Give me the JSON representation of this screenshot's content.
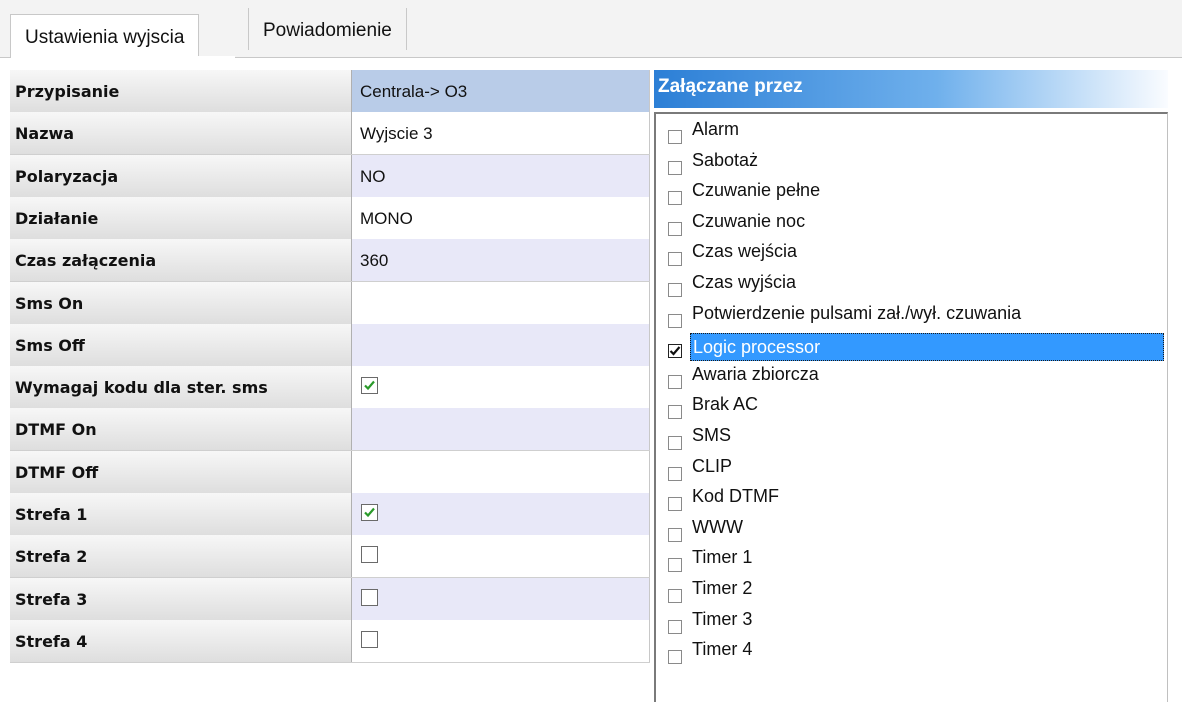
{
  "tabs": [
    {
      "label": "Ustawienia wyjscia",
      "active": true
    },
    {
      "label": "Powiadomienie",
      "active": false
    }
  ],
  "properties": [
    {
      "label": "Przypisanie",
      "value": "Centrala-> O3",
      "kind": "text"
    },
    {
      "label": "Nazwa",
      "value": "Wyjscie 3",
      "kind": "text"
    },
    {
      "label": "Polaryzacja",
      "value": "NO",
      "kind": "text"
    },
    {
      "label": "Działanie",
      "value": "MONO",
      "kind": "text"
    },
    {
      "label": "Czas załączenia",
      "value": "360",
      "kind": "text"
    },
    {
      "label": "Sms On",
      "value": "",
      "kind": "text"
    },
    {
      "label": "Sms Off",
      "value": "",
      "kind": "text"
    },
    {
      "label": "Wymagaj kodu dla ster. sms",
      "checked": true,
      "kind": "checkbox"
    },
    {
      "label": "DTMF On",
      "value": "",
      "kind": "text"
    },
    {
      "label": "DTMF Off",
      "value": "",
      "kind": "text"
    },
    {
      "label": "Strefa 1",
      "checked": true,
      "kind": "checkbox"
    },
    {
      "label": "Strefa 2",
      "checked": false,
      "kind": "checkbox"
    },
    {
      "label": "Strefa 3",
      "checked": false,
      "kind": "checkbox"
    },
    {
      "label": "Strefa 4",
      "checked": false,
      "kind": "checkbox"
    }
  ],
  "triggered_by": {
    "title": "Załączane przez",
    "items": [
      {
        "label": "Alarm",
        "checked": false
      },
      {
        "label": "Sabotaż",
        "checked": false
      },
      {
        "label": "Czuwanie pełne",
        "checked": false
      },
      {
        "label": "Czuwanie noc",
        "checked": false
      },
      {
        "label": "Czas wejścia",
        "checked": false
      },
      {
        "label": "Czas wyjścia",
        "checked": false
      },
      {
        "label": "Potwierdzenie pulsami zał./wył. czuwania",
        "checked": false
      },
      {
        "label": "Logic processor",
        "checked": true,
        "selected": true
      },
      {
        "label": "Awaria zbiorcza",
        "checked": false
      },
      {
        "label": "Brak AC",
        "checked": false
      },
      {
        "label": "SMS",
        "checked": false
      },
      {
        "label": "CLIP",
        "checked": false
      },
      {
        "label": "Kod DTMF",
        "checked": false
      },
      {
        "label": "WWW",
        "checked": false
      },
      {
        "label": "Timer 1",
        "checked": false
      },
      {
        "label": "Timer 2",
        "checked": false
      },
      {
        "label": "Timer 3",
        "checked": false
      },
      {
        "label": "Timer 4",
        "checked": false
      }
    ]
  },
  "colors": {
    "header_gradient_start": "#2c7fd6",
    "selection": "#3399ff",
    "check_green": "#2a9a2a"
  }
}
